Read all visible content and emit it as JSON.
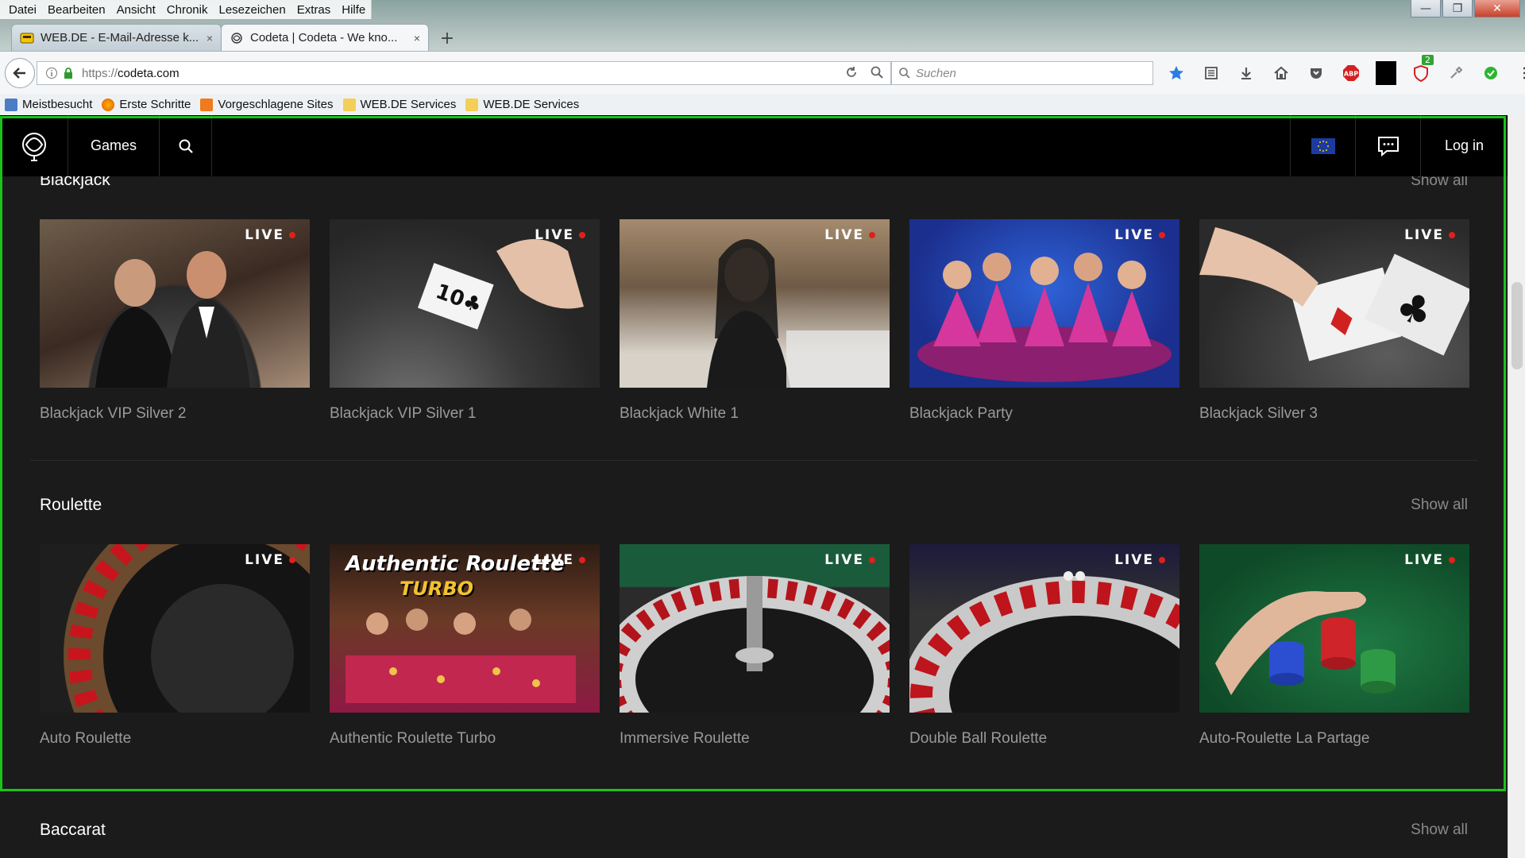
{
  "browser": {
    "menu": [
      "Datei",
      "Bearbeiten",
      "Ansicht",
      "Chronik",
      "Lesezeichen",
      "Extras",
      "Hilfe"
    ],
    "tabs": [
      {
        "label": "WEB.DE - E-Mail-Adresse k...",
        "close": "×"
      },
      {
        "label": "Codeta | Codeta - We kno...",
        "close": "×"
      }
    ],
    "new_tab": "+",
    "url_protocol": "https://",
    "url_host": "codeta.com",
    "search_placeholder": "Suchen",
    "badge_count": "2",
    "bookmarks": [
      "Meistbesucht",
      "Erste Schritte",
      "Vorgeschlagene Sites",
      "WEB.DE Services",
      "WEB.DE Services"
    ]
  },
  "site": {
    "nav": {
      "games": "Games",
      "login": "Log in"
    },
    "live_label": "LIVE",
    "show_all": "Show all",
    "sections": [
      {
        "title": "Blackjack",
        "games": [
          "Blackjack VIP Silver 2",
          "Blackjack VIP Silver 1",
          "Blackjack White 1",
          "Blackjack Party",
          "Blackjack Silver 3"
        ]
      },
      {
        "title": "Roulette",
        "games": [
          "Auto Roulette",
          "Authentic Roulette Turbo",
          "Immersive Roulette",
          "Double Ball Roulette",
          "Auto-Roulette La Partage"
        ]
      },
      {
        "title": "Baccarat",
        "games": []
      }
    ],
    "promo": {
      "line1": "Authentic Roulette",
      "line2": "TURBO"
    }
  },
  "colors": {
    "accent_live_dot": "#e0201c",
    "frame_green": "#19c419",
    "site_bg": "#1b1b1b"
  }
}
